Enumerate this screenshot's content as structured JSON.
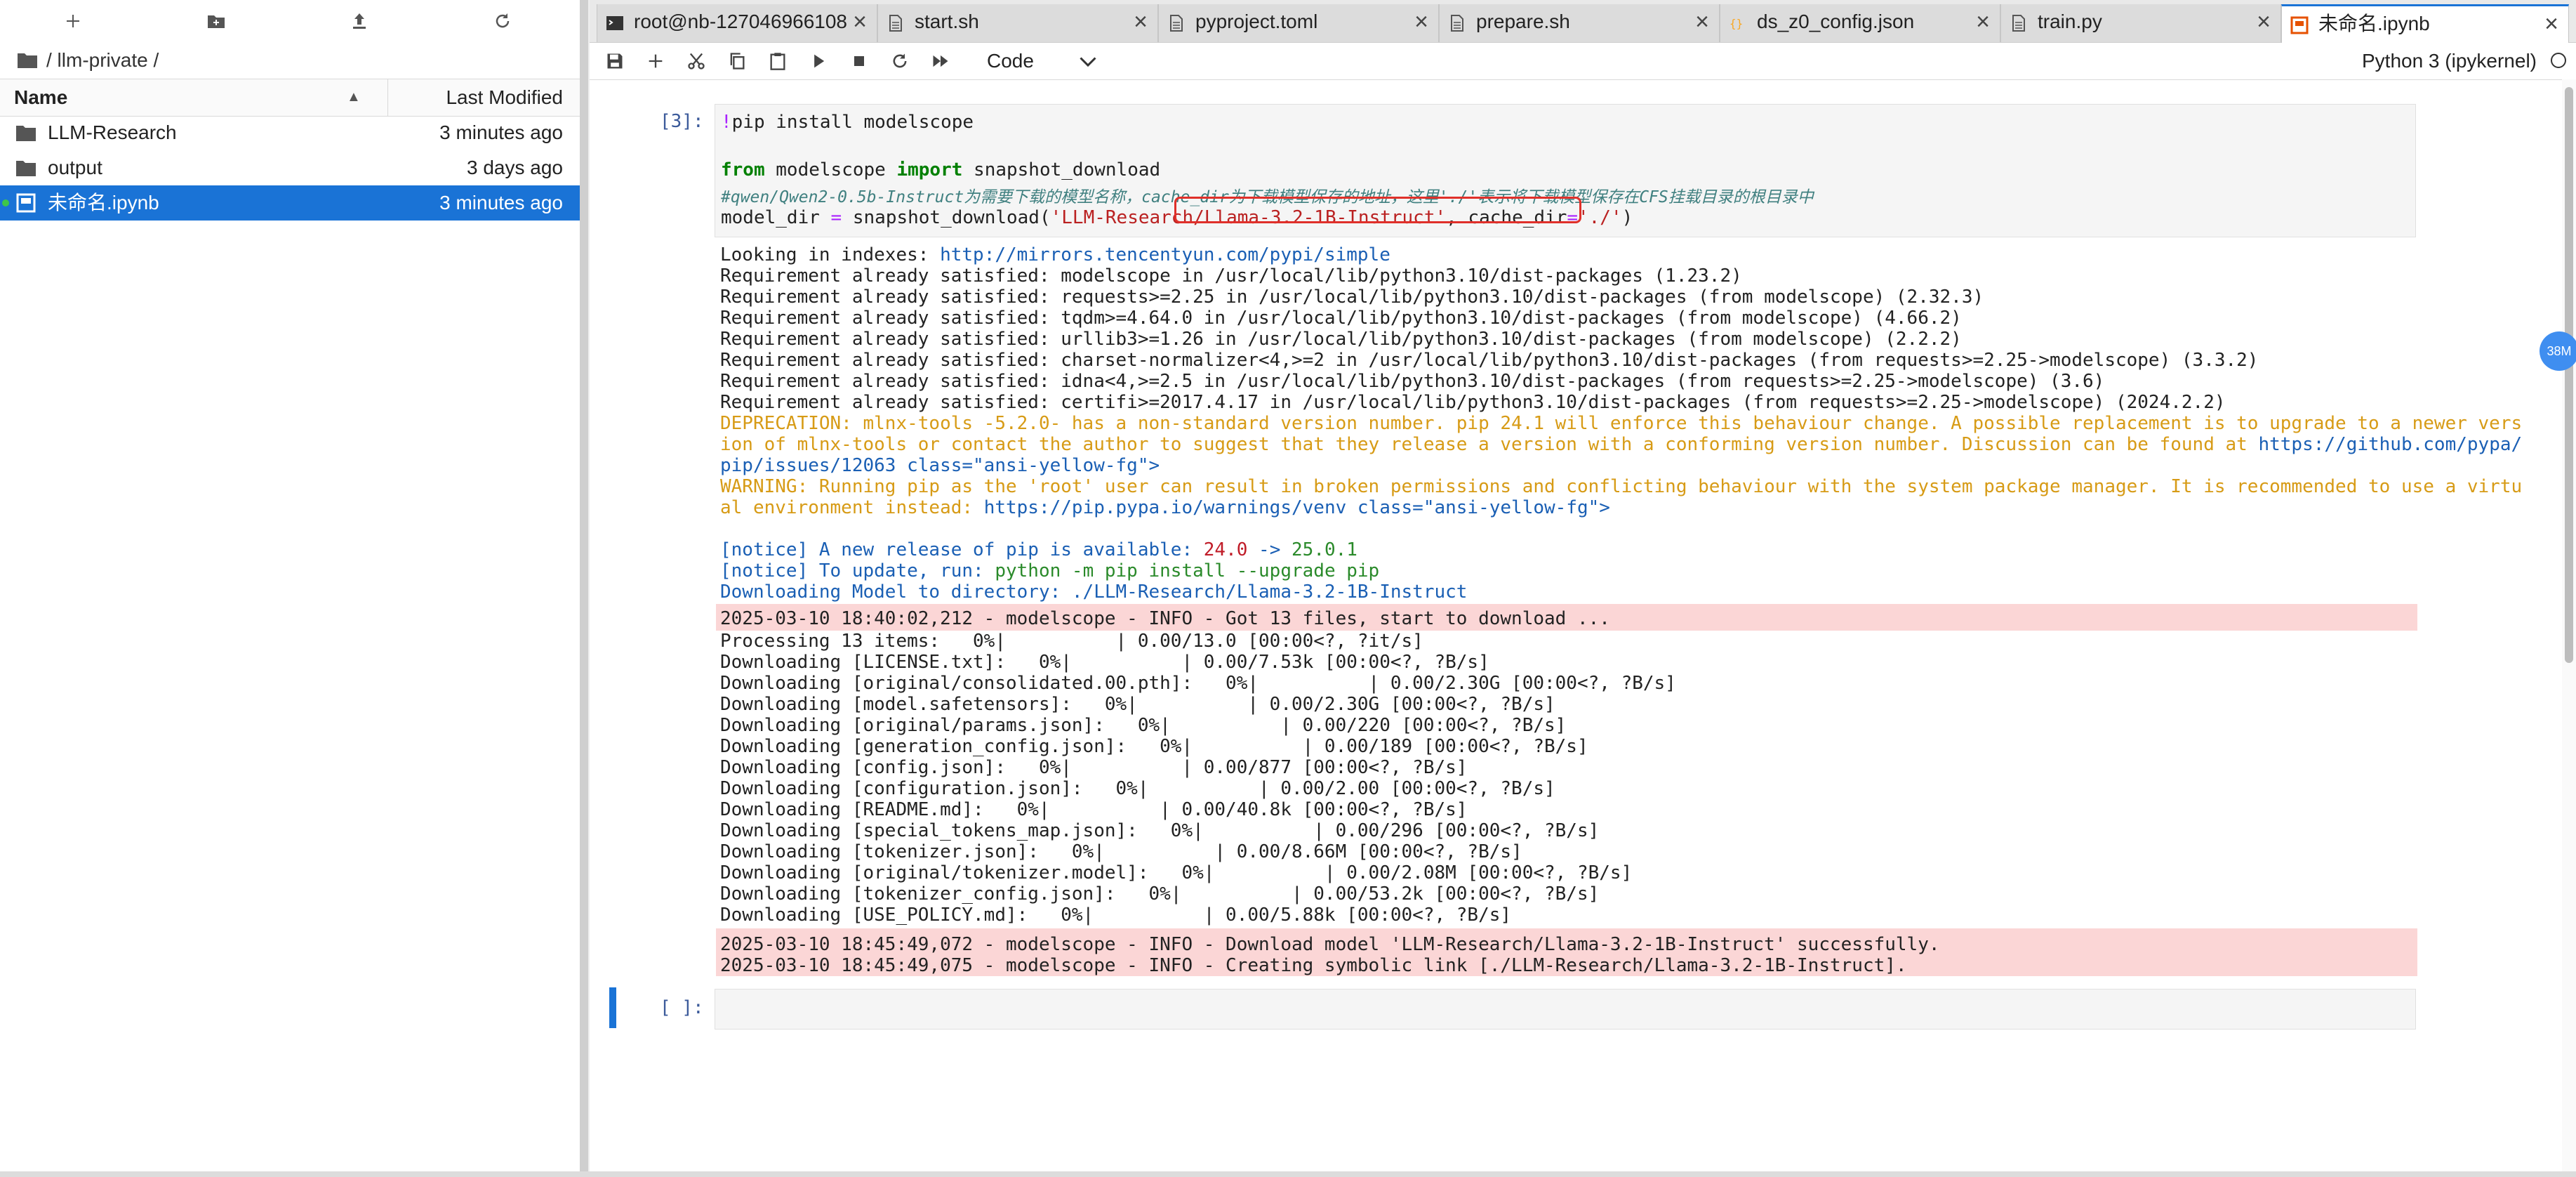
{
  "file_browser": {
    "toolbar_icons": [
      "new-launcher-icon",
      "new-folder-icon",
      "upload-icon",
      "refresh-icon"
    ],
    "breadcrumb": "/ llm-private /",
    "columns": {
      "name": "Name",
      "modified": "Last Modified"
    },
    "items": [
      {
        "name": "LLM-Research",
        "modified": "3 minutes ago",
        "type": "folder"
      },
      {
        "name": "output",
        "modified": "3 days ago",
        "type": "folder"
      },
      {
        "name": "未命名.ipynb",
        "modified": "3 minutes ago",
        "type": "notebook"
      }
    ]
  },
  "tabs": [
    {
      "label": "root@nb-127046966108",
      "icon": "terminal-icon"
    },
    {
      "label": "start.sh",
      "icon": "file-icon"
    },
    {
      "label": "pyproject.toml",
      "icon": "file-icon"
    },
    {
      "label": "prepare.sh",
      "icon": "file-icon"
    },
    {
      "label": "ds_z0_config.json",
      "icon": "json-icon"
    },
    {
      "label": "train.py",
      "icon": "file-icon"
    },
    {
      "label": "未命名.ipynb",
      "icon": "notebook-icon"
    }
  ],
  "notebook_toolbar": {
    "cell_type": "Code",
    "kernel": "Python 3 (ipykernel)"
  },
  "cell1": {
    "prompt": "[3]:",
    "code": {
      "line1_bang": "!",
      "line1_rest": "pip install modelscope",
      "line2_from": "from",
      "line2_mid": " modelscope ",
      "line2_import": "import",
      "line2_end": " snapshot_download",
      "line3_comment": "#qwen/Qwen2-0.5b-Instruct为需要下载的模型名称，cache_dir为下载模型保存的地址，这里'./'表示将下载模型保存在CFS挂载目录的根目录中",
      "line4_a": "model_dir ",
      "line4_eq": "=",
      "line4_b": " snapshot_download(",
      "line4_str1": "'LLM-Research/Llama-3.2-1B-Instruct'",
      "line4_c": ", cache_dir",
      "line4_eq2": "=",
      "line4_str2": "'./'",
      "line4_d": ")"
    },
    "output": {
      "indexes_label": "Looking in indexes: ",
      "indexes_url": "http://mirrors.tencentyun.com/pypi/simple",
      "requirements": [
        "Requirement already satisfied: modelscope in /usr/local/lib/python3.10/dist-packages (1.23.2)",
        "Requirement already satisfied: requests>=2.25 in /usr/local/lib/python3.10/dist-packages (from modelscope) (2.32.3)",
        "Requirement already satisfied: tqdm>=4.64.0 in /usr/local/lib/python3.10/dist-packages (from modelscope) (4.66.2)",
        "Requirement already satisfied: urllib3>=1.26 in /usr/local/lib/python3.10/dist-packages (from modelscope) (2.2.2)",
        "Requirement already satisfied: charset-normalizer<4,>=2 in /usr/local/lib/python3.10/dist-packages (from requests>=2.25->modelscope) (3.3.2)",
        "Requirement already satisfied: idna<4,>=2.5 in /usr/local/lib/python3.10/dist-packages (from requests>=2.25->modelscope) (3.6)",
        "Requirement already satisfied: certifi>=2017.4.17 in /usr/local/lib/python3.10/dist-packages (from requests>=2.25->modelscope) (2024.2.2)"
      ],
      "deprecation_1": "DEPRECATION: mlnx-tools -5.2.0- has a non-standard version number. pip 24.1 will enforce this behaviour change. A possible replacement is to upgrade to a newer vers",
      "deprecation_2a": "ion of mlnx-tools or contact the author to suggest that they release a version with a conforming version number. Discussion can be found at ",
      "deprecation_2b": "https://github.com/pypa/",
      "deprecation_3": "pip/issues/12063 class=\"ansi-yellow-fg\">",
      "warning_1": "WARNING: Running pip as the 'root' user can result in broken permissions and conflicting behaviour with the system package manager. It is recommended to use a virtu",
      "warning_2a": "al environment instead: ",
      "warning_2b": "https://pip.pypa.io/warnings/venv class=\"ansi-yellow-fg\">",
      "notice_1a": "[notice]",
      "notice_1b": " A new release of pip is available: ",
      "notice_1c": "24.0",
      "notice_1d": " -> ",
      "notice_1e": "25.0.1",
      "notice_2a": "[notice]",
      "notice_2b": " To update, run: ",
      "notice_2c": "python -m pip install --upgrade pip",
      "downloading_dir": "Downloading Model to directory: ./LLM-Research/Llama-3.2-1B-Instruct",
      "info_start": "2025-03-10 18:40:02,212 - modelscope - INFO - Got 13 files, start to download ...",
      "progress": [
        "Processing 13 items:   0%|          | 0.00/13.0 [00:00<?, ?it/s]",
        "Downloading [LICENSE.txt]:   0%|          | 0.00/7.53k [00:00<?, ?B/s]",
        "Downloading [original/consolidated.00.pth]:   0%|          | 0.00/2.30G [00:00<?, ?B/s]",
        "Downloading [model.safetensors]:   0%|          | 0.00/2.30G [00:00<?, ?B/s]",
        "Downloading [original/params.json]:   0%|          | 0.00/220 [00:00<?, ?B/s]",
        "Downloading [generation_config.json]:   0%|          | 0.00/189 [00:00<?, ?B/s]",
        "Downloading [config.json]:   0%|          | 0.00/877 [00:00<?, ?B/s]",
        "Downloading [configuration.json]:   0%|          | 0.00/2.00 [00:00<?, ?B/s]",
        "Downloading [README.md]:   0%|          | 0.00/40.8k [00:00<?, ?B/s]",
        "Downloading [special_tokens_map.json]:   0%|          | 0.00/296 [00:00<?, ?B/s]",
        "Downloading [tokenizer.json]:   0%|          | 0.00/8.66M [00:00<?, ?B/s]",
        "Downloading [original/tokenizer.model]:   0%|          | 0.00/2.08M [00:00<?, ?B/s]",
        "Downloading [tokenizer_config.json]:   0%|          | 0.00/53.2k [00:00<?, ?B/s]",
        "Downloading [USE_POLICY.md]:   0%|          | 0.00/5.88k [00:00<?, ?B/s]"
      ],
      "info_done_1": "2025-03-10 18:45:49,072 - modelscope - INFO - Download model 'LLM-Research/Llama-3.2-1B-Instruct' successfully.",
      "info_done_2": "2025-03-10 18:45:49,075 - modelscope - INFO - Creating symbolic link [./LLM-Research/Llama-3.2-1B-Instruct]."
    }
  },
  "cell2": {
    "prompt": "[ ]:"
  },
  "memory_badge": "38M",
  "colors": {
    "accent": "#1a73d6",
    "highlight_box": "#e0302a",
    "error_background": "#fbd6d6",
    "warning_text": "#d79b16"
  }
}
